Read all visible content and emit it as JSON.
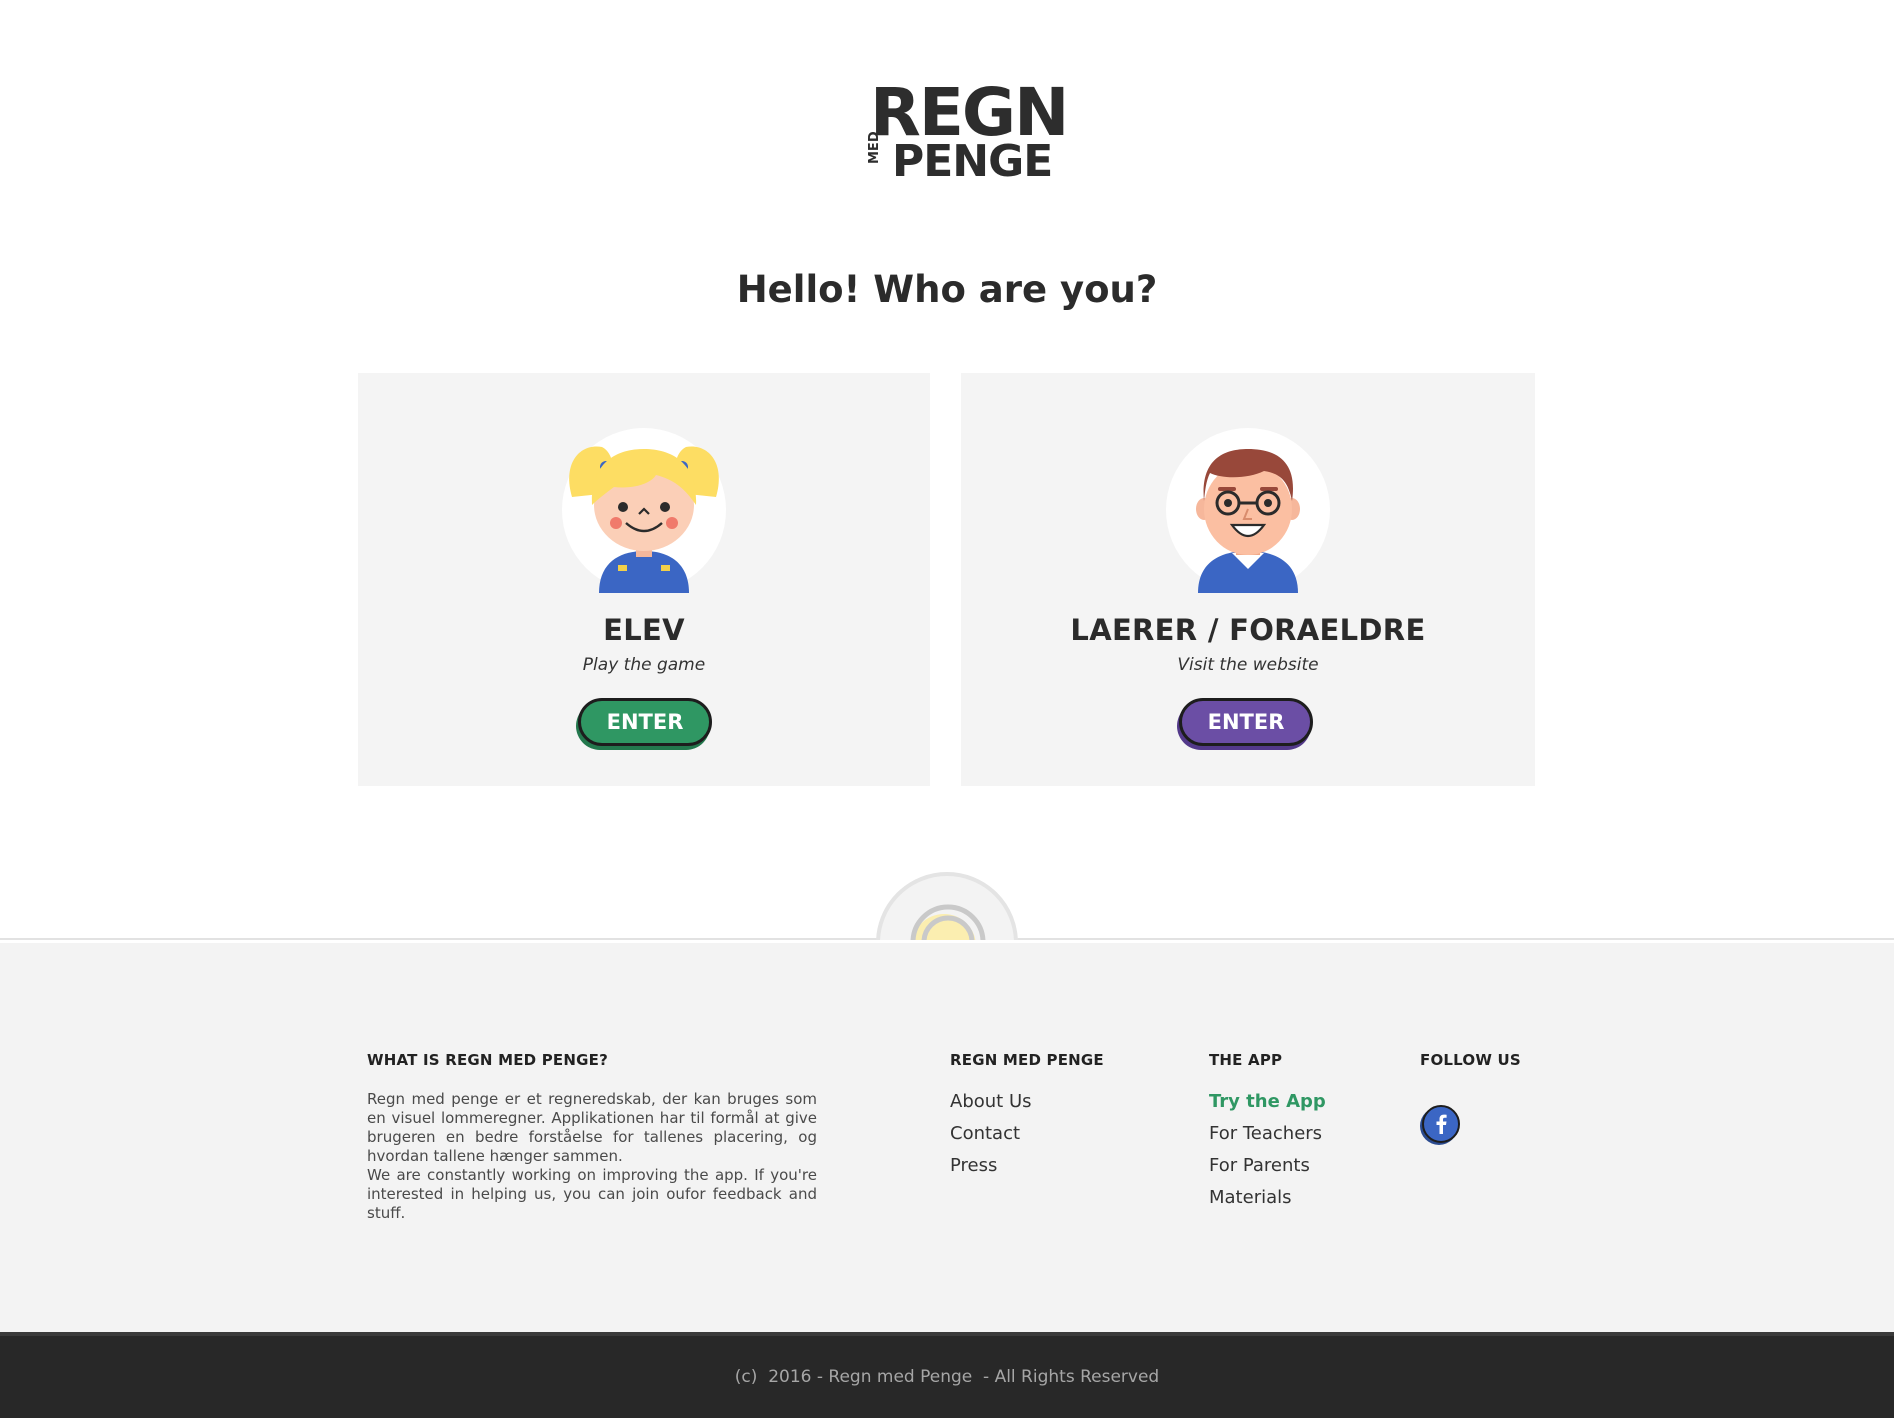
{
  "brand": {
    "logo_word_top": "REGN",
    "logo_word_small": "MED",
    "logo_word_bottom": "PENGE"
  },
  "hero": {
    "greeting": "Hello! Who are you?"
  },
  "cards": [
    {
      "title": "ELEV",
      "subtitle": "Play the game",
      "button_label": "ENTER",
      "button_color": "#2f9763",
      "avatar": "girl-avatar-icon"
    },
    {
      "title": "LAERER / FORAELDRE",
      "subtitle": "Visit the website",
      "button_label": "ENTER",
      "button_color": "#6b4ea5",
      "avatar": "teacher-avatar-icon"
    }
  ],
  "footer": {
    "about": {
      "heading": "WHAT IS REGN MED PENGE?",
      "paragraph1": "Regn med penge er et regneredskab, der kan bruges som en visuel lommeregner. Applikationen har til formål at give brugeren en bedre forståelse for tallenes placering, og hvordan tallene hænger sammen.",
      "paragraph2": "We are constantly working on improving the app. If you're interested in helping us, you can join oufor feedback and stuff."
    },
    "regn_col": {
      "heading": "REGN MED PENGE",
      "links": [
        "About Us",
        "Contact",
        "Press"
      ]
    },
    "app_col": {
      "heading": "THE APP",
      "links": [
        "Try the App",
        "For Teachers",
        "For Parents",
        "Materials"
      ]
    },
    "follow_col": {
      "heading": "FOLLOW US",
      "icon": "facebook-icon"
    },
    "copyright": "(c)  2016 - Regn med Penge  - All Rights Reserved"
  },
  "colors": {
    "accent_green": "#2f9763",
    "accent_purple": "#6b4ea5",
    "card_bg": "#f4f4f4",
    "footer_bg": "#f3f3f3",
    "bottom_bar": "#282828"
  }
}
